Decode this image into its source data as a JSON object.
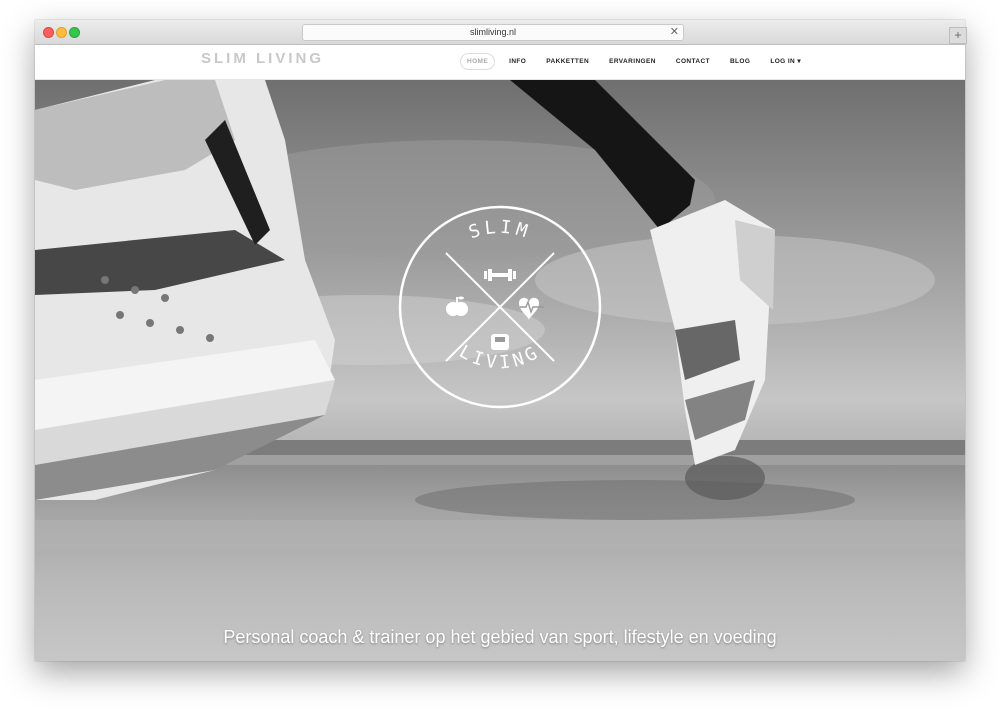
{
  "browser": {
    "url": "slimliving.nl",
    "close_glyph": "✕",
    "new_tab_glyph": "+"
  },
  "site": {
    "brand": "SLIM LIVING",
    "menu": [
      {
        "label": "HOME",
        "active": true
      },
      {
        "label": "INFO"
      },
      {
        "label": "PAKKETTEN"
      },
      {
        "label": "ERVARINGEN"
      },
      {
        "label": "CONTACT"
      },
      {
        "label": "BLOG"
      },
      {
        "label": "LOG IN ▾"
      }
    ]
  },
  "hero": {
    "logo_top": "SLIM",
    "logo_bottom": "LIVING",
    "logo_icons": [
      "dumbbell-icon",
      "apple-icon",
      "heartbeat-icon",
      "scale-icon"
    ],
    "tagline": "Personal coach & trainer op het gebied van sport, lifestyle en voeding"
  }
}
